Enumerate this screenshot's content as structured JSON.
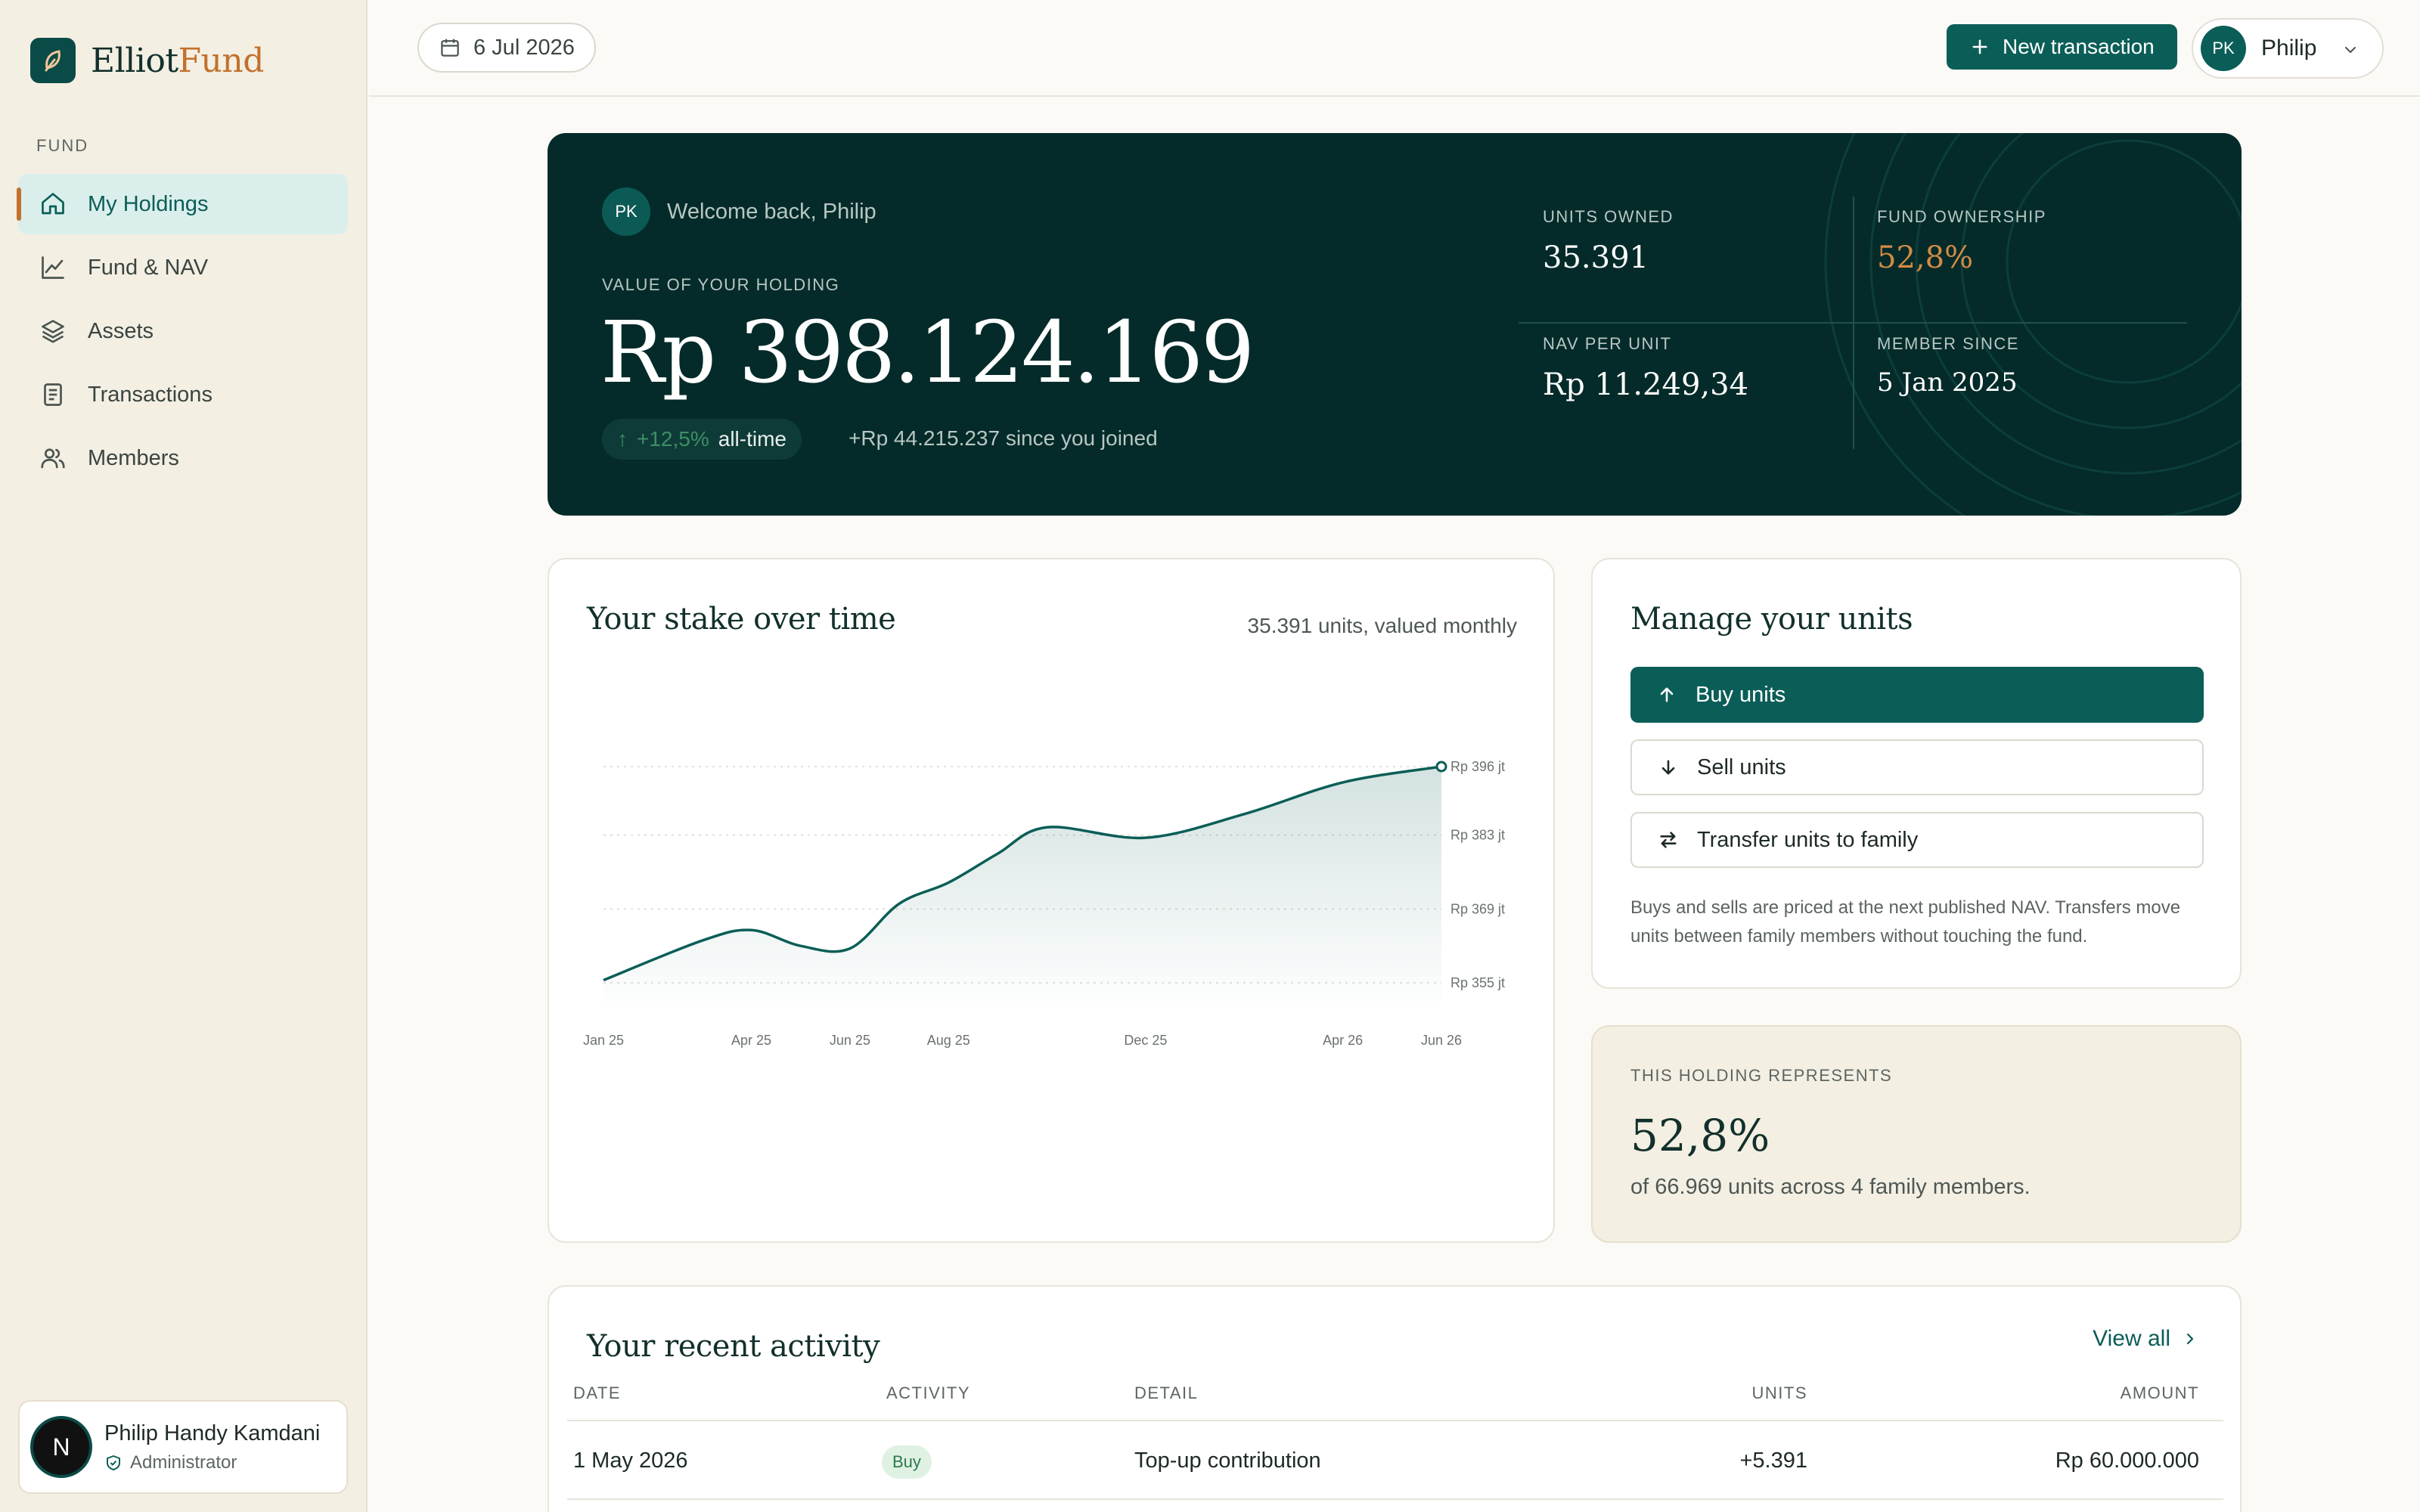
{
  "brand": {
    "name_part1": "Elliot",
    "name_part2": "Fund"
  },
  "sidebar": {
    "section_label": "FUND",
    "items": [
      {
        "label": "My Holdings",
        "icon": "home-icon",
        "active": true
      },
      {
        "label": "Fund & NAV",
        "icon": "line-chart-icon"
      },
      {
        "label": "Assets",
        "icon": "layers-icon"
      },
      {
        "label": "Transactions",
        "icon": "document-icon"
      },
      {
        "label": "Members",
        "icon": "users-icon"
      }
    ],
    "user": {
      "avatar_letter": "N",
      "name": "Philip Handy Kamdani",
      "role": "Administrator"
    }
  },
  "topbar": {
    "date": "6 Jul 2026",
    "new_transaction_label": "New transaction",
    "profile": {
      "initials": "PK",
      "name": "Philip"
    }
  },
  "hero": {
    "initials": "PK",
    "welcome": "Welcome back, Philip",
    "value_label": "VALUE OF YOUR HOLDING",
    "value": "Rp 398.124.169",
    "alltime_pct": "+12,5%",
    "alltime_label": "all-time",
    "since_joined": "+Rp 44.215.237 since you joined",
    "stats": {
      "units_owned_label": "UNITS OWNED",
      "units_owned": "35.391",
      "fund_ownership_label": "FUND OWNERSHIP",
      "fund_ownership": "52,8%",
      "nav_per_unit_label": "NAV PER UNIT",
      "nav_per_unit": "Rp 11.249,34",
      "member_since_label": "MEMBER SINCE",
      "member_since": "5 Jan 2025"
    },
    "colors": {
      "background": "#042b29",
      "accent": "#d58a45"
    }
  },
  "stake_chart": {
    "title": "Your stake over time",
    "subtitle": "35.391 units, valued monthly"
  },
  "chart_data": {
    "type": "area",
    "title": "Your stake over time",
    "x_tick_labels": [
      "Jan 25",
      "Apr 25",
      "Jun 25",
      "Aug 25",
      "Dec 25",
      "Apr 26",
      "Jun 26"
    ],
    "y_tick_labels": [
      "Rp 396 jt",
      "Rp 383 jt",
      "Rp 369 jt",
      "Rp 355 jt"
    ],
    "y_ticks": [
      396,
      383,
      369,
      355
    ],
    "ylim": [
      355,
      396
    ],
    "y_unit": "Rp jt",
    "grid": true,
    "series": [
      {
        "values": [
          {
            "x": "2025-01",
            "y": 355.5
          },
          {
            "x": "2025-03",
            "y": 363.0
          },
          {
            "x": "2025-04",
            "y": 365.0
          },
          {
            "x": "2025-05",
            "y": 362.0
          },
          {
            "x": "2025-06",
            "y": 361.5
          },
          {
            "x": "2025-07",
            "y": 370.0
          },
          {
            "x": "2025-08",
            "y": 374.0
          },
          {
            "x": "2025-09",
            "y": 379.5
          },
          {
            "x": "2025-10",
            "y": 384.5
          },
          {
            "x": "2025-12",
            "y": 382.5
          },
          {
            "x": "2026-02",
            "y": 387.0
          },
          {
            "x": "2026-04",
            "y": 393.0
          },
          {
            "x": "2026-06",
            "y": 396.0
          }
        ]
      }
    ],
    "colors": {
      "line": "#0b5e57",
      "fill": "#0b5e57"
    }
  },
  "manage": {
    "title": "Manage your units",
    "buy_label": "Buy units",
    "sell_label": "Sell units",
    "transfer_label": "Transfer units to family",
    "note": "Buys and sells are priced at the next published NAV. Transfers move units between family members without touching the fund."
  },
  "represents": {
    "label": "THIS HOLDING REPRESENTS",
    "value": "52,8%",
    "sub": "of 66.969 units across 4 family members."
  },
  "activity": {
    "title": "Your recent activity",
    "view_all": "View all",
    "columns": [
      "DATE",
      "ACTIVITY",
      "DETAIL",
      "UNITS",
      "AMOUNT"
    ],
    "rows": [
      {
        "date": "1 May 2026",
        "activity": "Buy",
        "detail": "Top-up contribution",
        "units": "+5.391",
        "amount": "Rp 60.000.000"
      }
    ]
  }
}
